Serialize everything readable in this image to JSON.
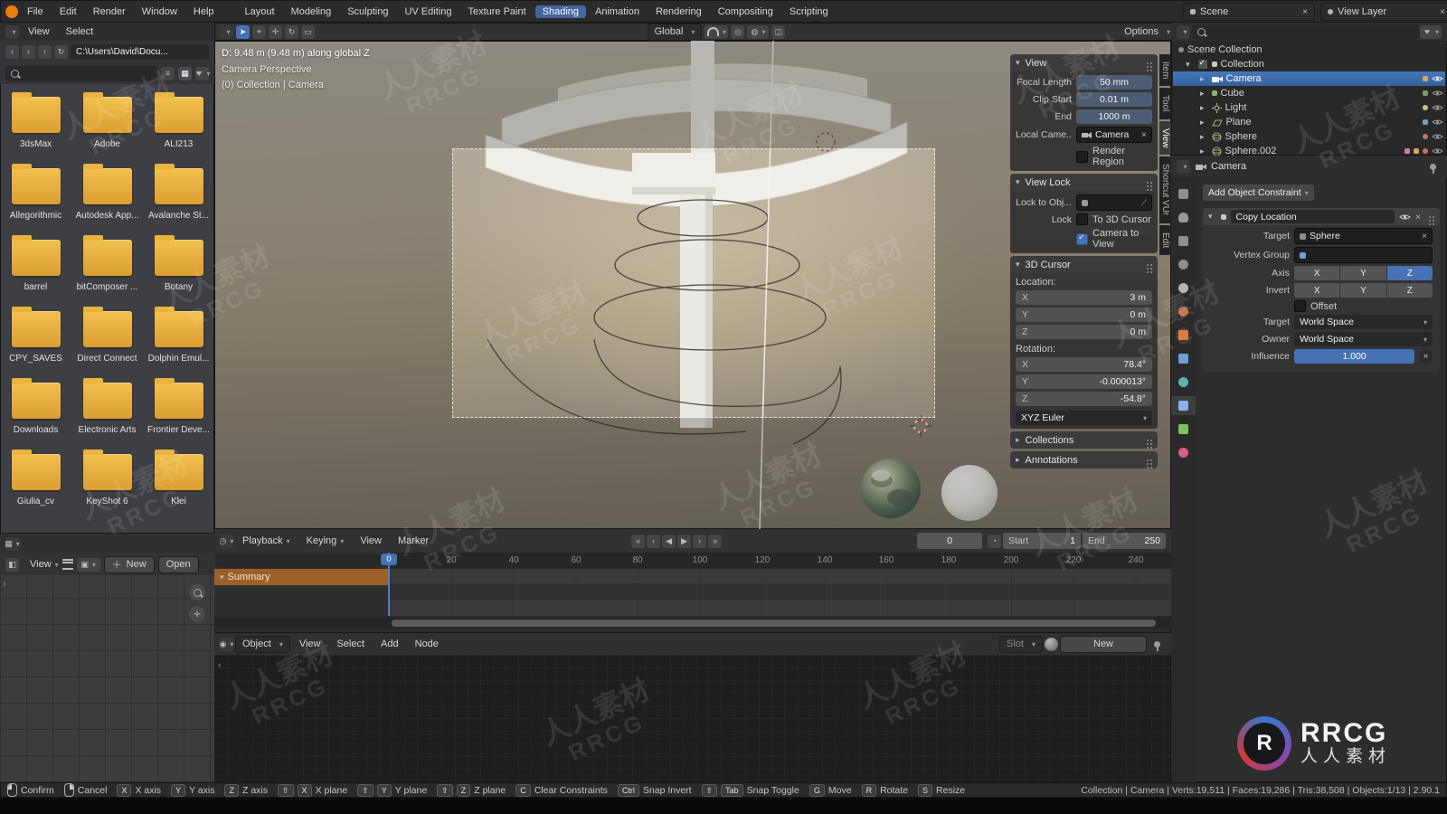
{
  "watermark": {
    "text_cn": "人人素材",
    "text_en": "RRCG"
  },
  "logo": {
    "monogram": "R",
    "title": "RRCG",
    "subtitle": "人人素材"
  },
  "topbar": {
    "menus": [
      "File",
      "Edit",
      "Render",
      "Window",
      "Help"
    ],
    "tabs": [
      "Layout",
      "Modeling",
      "Sculpting",
      "UV Editing",
      "Texture Paint",
      "Shading",
      "Animation",
      "Rendering",
      "Compositing",
      "Scripting"
    ],
    "scene_label": "Scene",
    "view_layer_label": "View Layer"
  },
  "file_browser": {
    "menus": [
      "View",
      "Select"
    ],
    "path": "C:\\Users\\David\\Docu...",
    "folders": [
      "3dsMax",
      "Adobe",
      "ALI213",
      "Allegorithmic",
      "Autodesk App...",
      "Avalanche St...",
      "barrel",
      "bitComposer ...",
      "Botany",
      "CPY_SAVES",
      "Direct Connect",
      "Dolphin Emul...",
      "Downloads",
      "Electronic Arts",
      "Frontier Deve...",
      "Giulia_cv",
      "KeyShot 6",
      "Klei"
    ]
  },
  "viewport": {
    "header": {
      "orientation": "Global",
      "options": "Options"
    },
    "hud": {
      "distance": "D: 9.48 m (9.48 m) along global Z",
      "view_name": "Camera Perspective",
      "context": "(0) Collection | Camera"
    },
    "sidebar_tabs": [
      "Item",
      "Tool",
      "View",
      "Shortcut VUr",
      "Edit"
    ],
    "npanel": {
      "view_title": "View",
      "focal_label": "Focal Length",
      "focal_value": "50 mm",
      "clip_start_label": "Clip Start",
      "clip_start_value": "0.01 m",
      "clip_end_label": "End",
      "clip_end_value": "1000 m",
      "local_cam_label": "Local Came...",
      "local_cam_value": "Camera",
      "render_region_label": "Render Region",
      "view_lock_title": "View Lock",
      "lock_obj_label": "Lock to Obj...",
      "lock_label": "Lock",
      "to_3d_cursor_label": "To 3D Cursor",
      "camera_to_view_label": "Camera to View",
      "cursor_title": "3D Cursor",
      "location_label": "Location:",
      "loc_x_axis": "X",
      "loc_x": "3 m",
      "loc_y_axis": "Y",
      "loc_y": "0 m",
      "loc_z_axis": "Z",
      "loc_z": "0 m",
      "rotation_label": "Rotation:",
      "rot_x_axis": "X",
      "rot_x": "78.4°",
      "rot_y_axis": "Y",
      "rot_y": "-0.000013°",
      "rot_z_axis": "Z",
      "rot_z": "-54.8°",
      "euler": "XYZ Euler",
      "collections_title": "Collections",
      "annotations_title": "Annotations"
    }
  },
  "outliner": {
    "scene_collection": "Scene Collection",
    "collection": "Collection",
    "objects": [
      {
        "name": "Camera"
      },
      {
        "name": "Cube"
      },
      {
        "name": "Light"
      },
      {
        "name": "Plane"
      },
      {
        "name": "Sphere"
      },
      {
        "name": "Sphere.002"
      }
    ]
  },
  "properties": {
    "breadcrumb": "Camera",
    "add_constraint_label": "Add Object Constraint",
    "constraint": {
      "name": "Copy Location",
      "target_label": "Target",
      "target_value": "Sphere",
      "vertex_group_label": "Vertex Group",
      "axis_label": "Axis",
      "axis_x": "X",
      "axis_y": "Y",
      "axis_z": "Z",
      "invert_label": "Invert",
      "offset_label": "Offset",
      "space_target_label": "Target",
      "space_target_value": "World Space",
      "owner_label": "Owner",
      "owner_value": "World Space",
      "influence_label": "Influence",
      "influence_value": "1.000"
    }
  },
  "timeline": {
    "menus": [
      "Playback",
      "Keying",
      "View",
      "Marker"
    ],
    "current_frame": "0",
    "start_label": "Start",
    "start_value": "1",
    "end_label": "End",
    "end_value": "250",
    "ticks": [
      "20",
      "40",
      "60",
      "80",
      "100",
      "120",
      "140",
      "160",
      "180",
      "200",
      "220",
      "240"
    ],
    "summary_label": "Summary"
  },
  "node_editor": {
    "shader_type": "Object",
    "menus": [
      "View",
      "Select",
      "Add",
      "Node"
    ],
    "slot_label": "Slot",
    "new_label": "New"
  },
  "image_editor": {
    "view_label": "View",
    "new_label": "New",
    "open_label": "Open"
  },
  "icons": {
    "jump_start": "«",
    "prev_key": "‹",
    "play_back": "◀",
    "play": "▶",
    "next_key": "›",
    "jump_end": "»"
  },
  "statusbar": {
    "hints": [
      {
        "label": "Confirm"
      },
      {
        "label": "Cancel"
      },
      {
        "keys": [
          "X"
        ],
        "label": "X axis"
      },
      {
        "keys": [
          "Y"
        ],
        "label": "Y axis"
      },
      {
        "keys": [
          "Z"
        ],
        "label": "Z axis"
      },
      {
        "keys": [
          "⇧",
          "X"
        ],
        "label": "X plane"
      },
      {
        "keys": [
          "⇧",
          "Y"
        ],
        "label": "Y plane"
      },
      {
        "keys": [
          "⇧",
          "Z"
        ],
        "label": "Z plane"
      },
      {
        "keys": [
          "C"
        ],
        "label": "Clear Constraints"
      },
      {
        "keys": [
          "Ctrl"
        ],
        "label": "Snap Invert"
      },
      {
        "keys": [
          "⇧",
          "Tab"
        ],
        "label": "Snap Toggle"
      },
      {
        "keys": [
          "G"
        ],
        "label": "Move"
      },
      {
        "keys": [
          "R"
        ],
        "label": "Rotate"
      },
      {
        "keys": [
          "S"
        ],
        "label": "Resize"
      }
    ],
    "stats": "Collection | Camera | Verts:19,511 | Faces:19,286 | Tris:38,508 | Objects:1/13 | 2.90.1"
  }
}
